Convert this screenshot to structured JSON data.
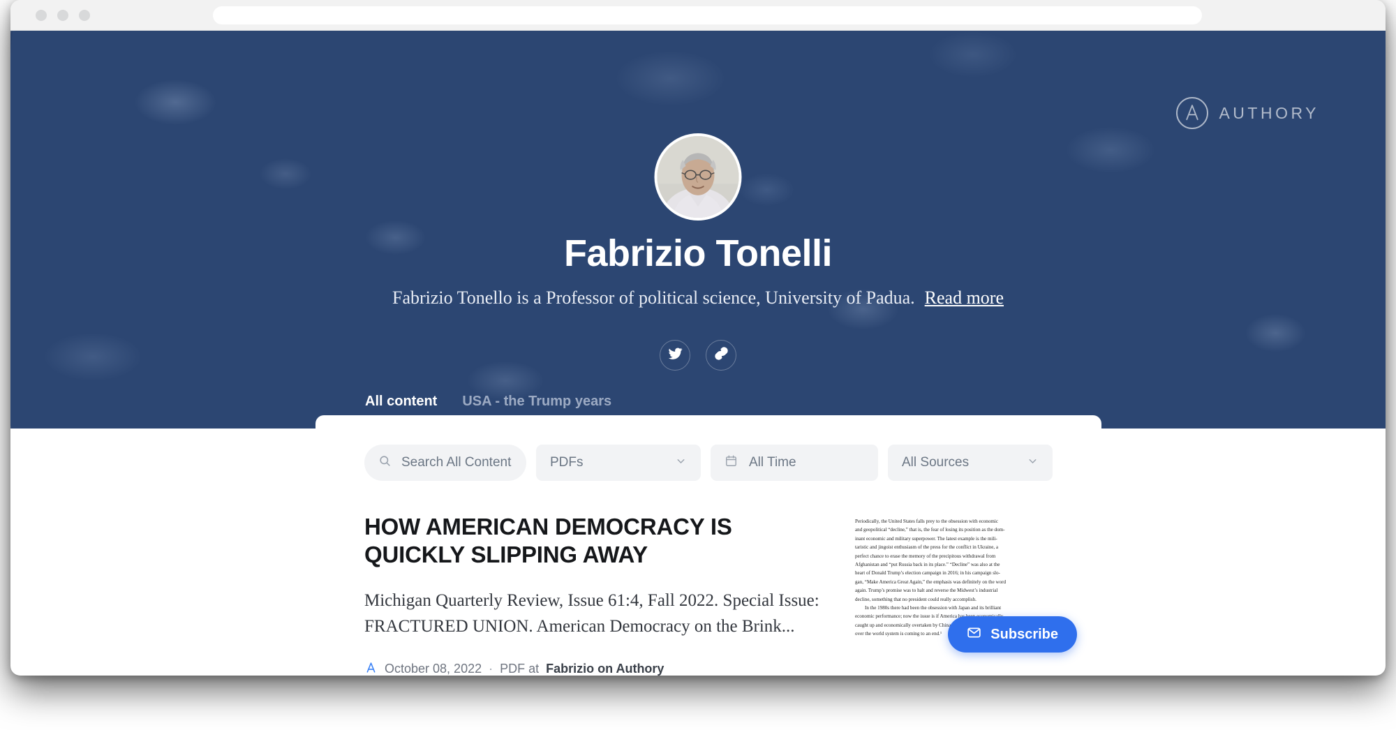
{
  "browser": {
    "url_value": "",
    "url_placeholder": ""
  },
  "brand": {
    "wordmark": "AUTHORY"
  },
  "profile": {
    "name": "Fabrizio Tonelli",
    "bio": "Fabrizio Tonello is a Professor of political science, University of Padua.",
    "read_more": "Read more",
    "socials": [
      {
        "name": "twitter",
        "icon": "twitter-icon"
      },
      {
        "name": "link",
        "icon": "link-icon"
      }
    ]
  },
  "tabs": [
    {
      "label": "All content",
      "active": true
    },
    {
      "label": "USA - the Trump years",
      "active": false
    }
  ],
  "filters": {
    "search_placeholder": "Search All Content",
    "search_value": "",
    "type_value": "PDFs",
    "date_value": "All Time",
    "source_value": "All Sources"
  },
  "article": {
    "title": "HOW AMERICAN DEMOCRACY IS QUICKLY SLIPPING AWAY",
    "description": "Michigan Quarterly Review, Issue 61:4, Fall 2022. Special Issue: FRACTURED UNION. American Democracy on the Brink...",
    "date": "October 08, 2022",
    "separator": "·",
    "source_prefix": "PDF at",
    "source": "Fabrizio on Authory",
    "preview_lines": [
      "Periodically, the United States falls prey to the obsession with economic",
      "and geopolitical “decline,” that is, the fear of losing its position as the dom-",
      "inant economic and military superpower. The latest example is the mili-",
      "taristic and jingoist enthusiasm of the press for the conflict in Ukraine, a",
      "perfect chance to erase the memory of the precipitous withdrawal from",
      "Afghanistan and “put Russia back in its place.” “Decline” was also at the",
      "heart of Donald Trump’s election campaign in 2016; in his campaign slo-",
      "gan, “Make America Great Again,” the emphasis was definitely on the word",
      "again. Trump’s promise was to halt and reverse the Midwest’s industrial",
      "decline, something that no president could really accomplish.",
      "In the 1980s there had been the obsession with Japan and its brilliant",
      "economic performance; now the issue is if America has been economically",
      "caught up and economically overtaken by China and if its long hegemony",
      "over the world system is coming to an end.¹"
    ]
  },
  "subscribe": {
    "label": "Subscribe",
    "icon": "envelope-icon",
    "color": "#2f6fed"
  },
  "colors": {
    "hero": "#2c4672",
    "accent": "#3b82f6",
    "pill_bg": "#f2f3f5",
    "pill_text": "#6b7684"
  }
}
